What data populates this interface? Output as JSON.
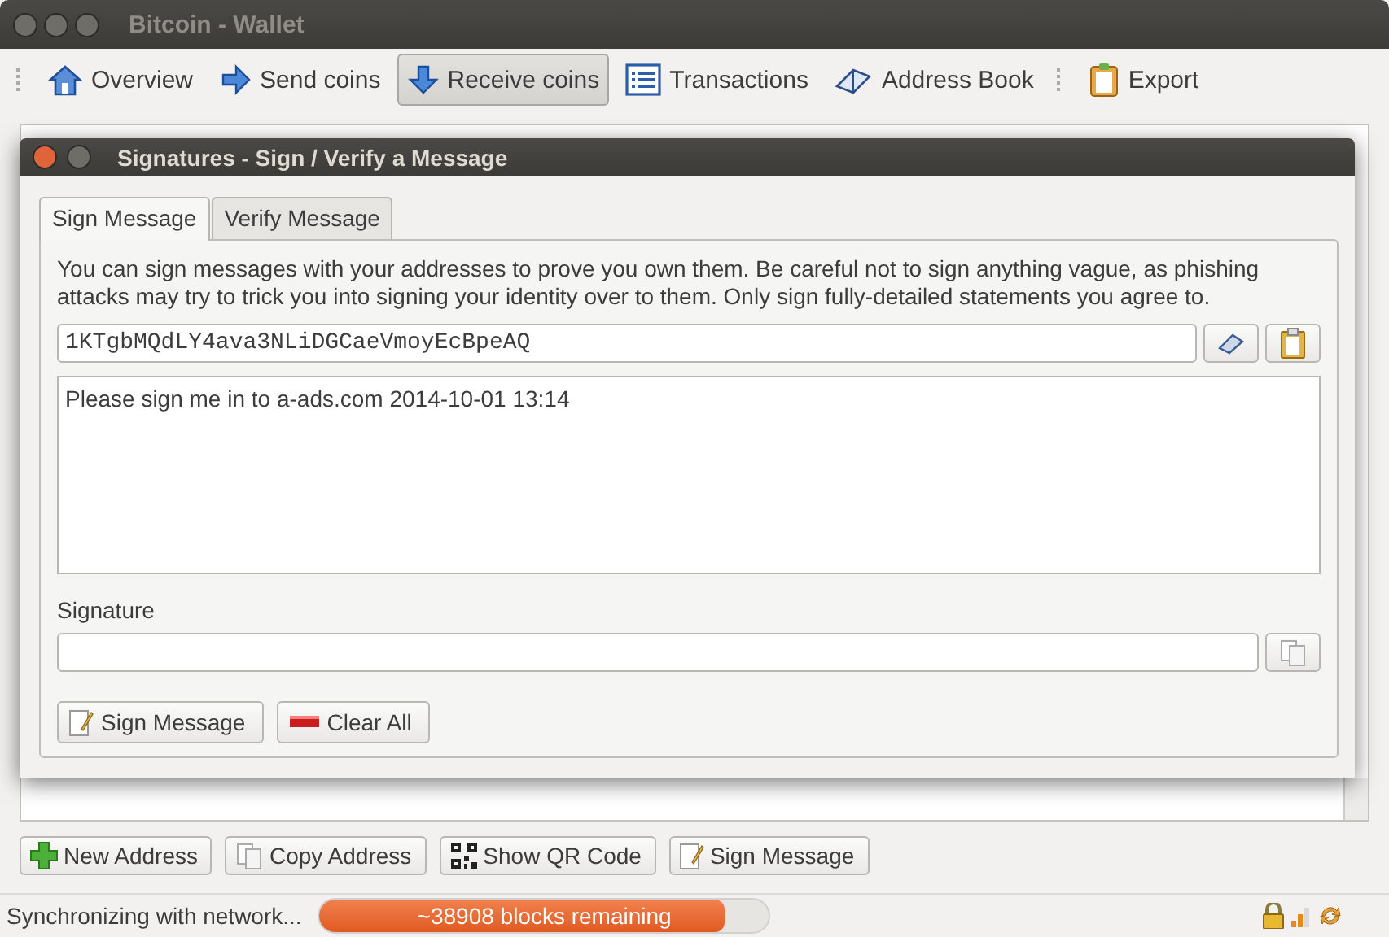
{
  "window": {
    "title": "Bitcoin - Wallet"
  },
  "toolbar": [
    {
      "label": "Overview",
      "selected": false
    },
    {
      "label": "Send coins",
      "selected": false
    },
    {
      "label": "Receive coins",
      "selected": true
    },
    {
      "label": "Transactions",
      "selected": false
    },
    {
      "label": "Address Book",
      "selected": false
    },
    {
      "label": "Export",
      "selected": false
    }
  ],
  "dialog": {
    "title": "Signatures - Sign / Verify a Message",
    "tabs": [
      {
        "label": "Sign Message",
        "selected": true
      },
      {
        "label": "Verify Message",
        "selected": false
      }
    ],
    "description": "You can sign messages with your addresses to prove you own them. Be careful not to sign anything vague, as phishing attacks may try to trick you into signing your identity over to them. Only sign fully-detailed statements you agree to.",
    "address": "1KTgbMQdLY4ava3NLiDGCaeVmoyEcBpeAQ",
    "message": "Please sign me in to a-ads.com 2014-10-01 13:14",
    "signature_label": "Signature",
    "buttons": [
      {
        "label": "Sign Message"
      },
      {
        "label": "Clear All"
      }
    ]
  },
  "actions": [
    {
      "label": "New Address"
    },
    {
      "label": "Copy Address"
    },
    {
      "label": "Show QR Code"
    },
    {
      "label": "Sign Message"
    }
  ],
  "status_bar": {
    "text": "Synchronizing with network...",
    "progress": {
      "level": 0.9,
      "label": "~38908 blocks remaining"
    }
  }
}
